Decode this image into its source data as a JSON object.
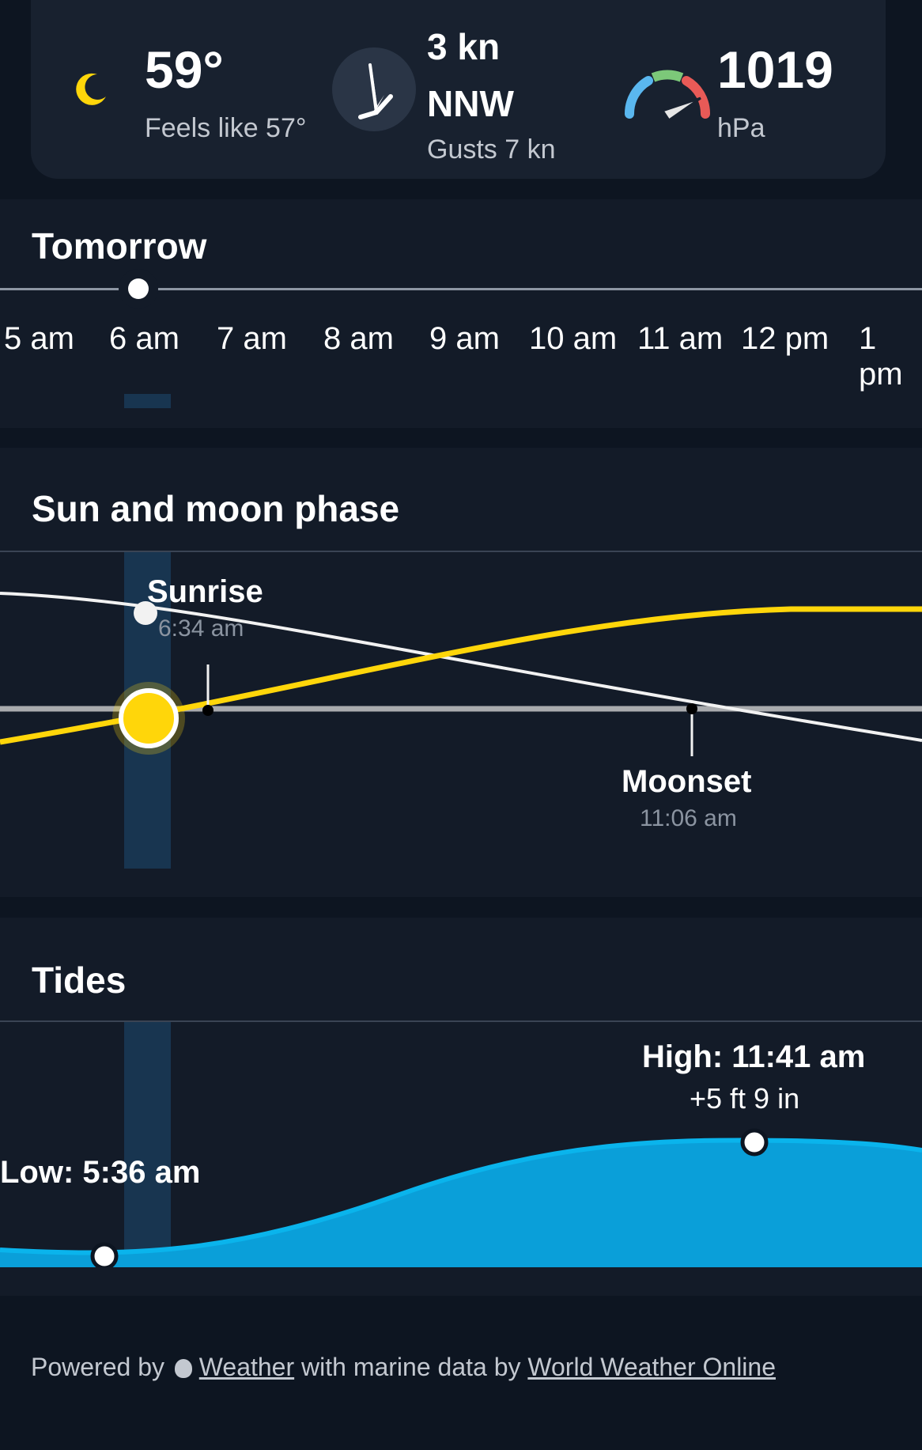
{
  "conditions": {
    "icon": "crescent-moon-icon",
    "temperature": "59°",
    "feels_like": "Feels like 57°",
    "wind_speed": "3 kn",
    "wind_direction": "NNW",
    "gusts": "Gusts 7 kn",
    "pressure": "1019",
    "pressure_unit": "hPa"
  },
  "tomorrow": {
    "title": "Tomorrow",
    "hours": [
      "5 am",
      "6 am",
      "7 am",
      "8 am",
      "9 am",
      "10 am",
      "11 am",
      "12 pm",
      "1 pm"
    ]
  },
  "sun_moon": {
    "title": "Sun and moon phase",
    "sunrise_label": "Sunrise",
    "sunrise_time": "6:34 am",
    "moonset_label": "Moonset",
    "moonset_time": "11:06 am"
  },
  "tides": {
    "title": "Tides",
    "low_label": "Low: 5:36 am",
    "high_label": "High: 11:41 am",
    "high_height": "+5 ft 9 in"
  },
  "footer": {
    "powered_by": "Powered by",
    "weather_link": "Weather",
    "marine_text": "with marine data by",
    "wwo_link": "World Weather Online"
  },
  "colors": {
    "background": "#0d1521",
    "card": "#18212f",
    "section": "#131b28",
    "sun": "#ffd60a",
    "tide": "#0aa6df",
    "highlight_column": "#183550"
  }
}
